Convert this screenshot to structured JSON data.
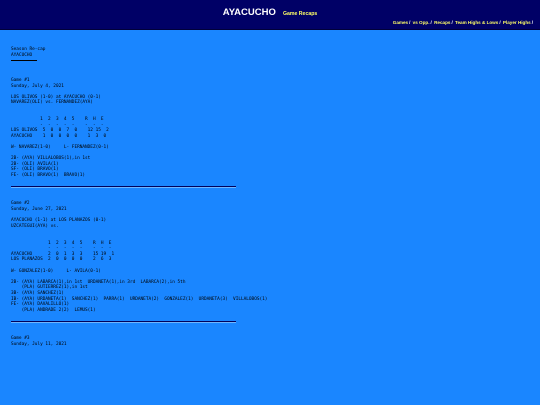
{
  "header": {
    "title": "AYACUCHO",
    "subtitle": "Game Recaps",
    "nav": [
      "Games",
      "vs Opp.",
      "Recaps",
      "Team Highs & Lows",
      "Player Highs"
    ],
    "nav_sep": "/"
  },
  "recap": {
    "heading": "Season Re-cap",
    "team": "AYACUCHO"
  },
  "games": [
    {
      "number": "Game #1",
      "date": "Sunday, July 4, 2021",
      "matchup": "LOS OLIVOS (1-0) at AYACUCHO (0-1)",
      "pitchers": "NAVAREZ(OLI) vs. FERNANDEZ(AYA)",
      "box_header": "           1  2  3  4  5    R  H  E",
      "box_dashes": "           -  -  -  -  -    -  -  -",
      "box_rows": [
        "LOS OLIVOS  5  0  0  7  0    12 15  2",
        "AYACUCHO    1  0  0  0  0    1  3  0"
      ],
      "decision": "W- NAVAREZ(1-0)     L- FERNANDEZ(0-1)",
      "notes": [
        "2B- (AYA) VILLALOBOS(1),in 1st",
        "2B- (OLI) AVILA(1)",
        "SF- (OLI) BRAVO(1)",
        "FE- (OLI) BRAVO(1)  BRAVO(1)"
      ]
    },
    {
      "number": "Game #2",
      "date": "Sunday, June 27, 2021",
      "matchup": "AYACUCHO (1-1) at LOS PLANAZOS (0-1)",
      "pitchers": "UZCATEGUI(AYA) vs.",
      "box_header": "              1  2  3  4  5    R  H  E",
      "box_dashes": "              -  -  -  -  -    -  -  -",
      "box_rows": [
        "AYACUCHO      2  0  1  3  3    15 19  1",
        "LOS PLANAZOS  2  0  0  0  0    2  6  3"
      ],
      "decision": "W- GONZALEZ(1-0)     L- AVILA(0-1)",
      "notes": [
        "2B- (AYA) LABARCA(1),in 1st  URDANETA(1),in 3rd  LABARCA(2),in 5th",
        "    (PLA) GUTIERREZ(1),in 1st",
        "3B- (AYA) SANCHEZ(1)",
        "IB- (AYA) URDANETA(1)  SANCHEZ(1)  PARRA(1)  URDANETA(2)  GONZALEZ(1)  URDANETA(3)  VILLALOBOS(1)",
        "FE- (AYA) DAVALILLO(1)",
        "    (PLA) ANDRADE 2(2)  LEMUS(1)"
      ]
    },
    {
      "number": "Game #3",
      "date": "Sunday, July 11, 2021"
    }
  ]
}
